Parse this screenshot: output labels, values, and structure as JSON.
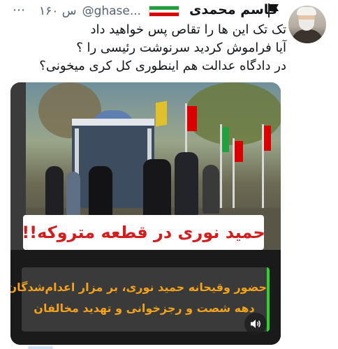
{
  "tweet": {
    "more_label": "⋯",
    "handle": "@ghase...",
    "time": "۱۶۰ س",
    "display_name": "قاسم محمدی",
    "text_lines": [
      "تک تک این ها را تقاص پس خواهید داد",
      "آیا فراموش کردید سرنوشت رئیسی را ؟",
      "در دادگاه عدالت هم اینطوری کل کری میخونی؟"
    ]
  },
  "media": {
    "title_overlay": "حمید نوری در قطعه متروکه!!",
    "caption_lines": [
      "حضور وقیحانه حمید نوری، بر مزار اعدام‌شدگان",
      "دهه شصت و رجزخوانی و تهدید مخالفان"
    ],
    "mute_icon": "speaker-icon"
  },
  "colors": {
    "flag_green": "#239f40",
    "flag_red": "#da0000",
    "title_red": "#d11f1f",
    "caption_orange": "#f3a21c",
    "caption_border_green": "#2fd12f"
  }
}
